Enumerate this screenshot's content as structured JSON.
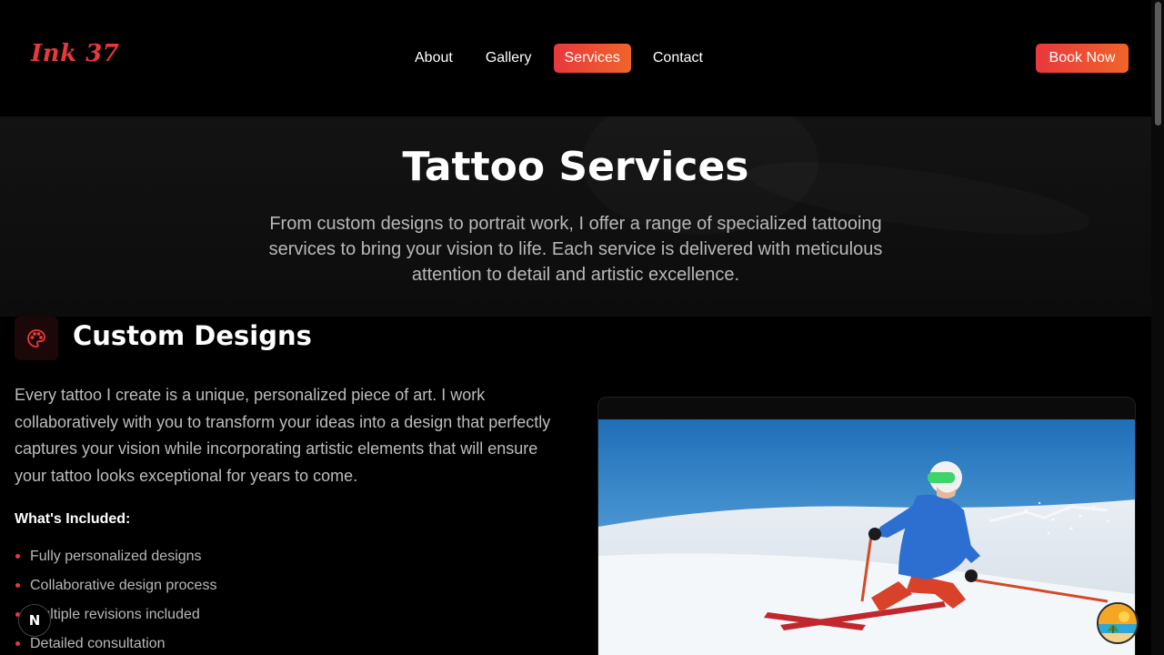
{
  "brand": {
    "logo": "Ink 37",
    "accent": "#e8383d",
    "accent_end": "#f0642a"
  },
  "nav": {
    "items": [
      {
        "label": "About",
        "active": false
      },
      {
        "label": "Gallery",
        "active": false
      },
      {
        "label": "Services",
        "active": true
      },
      {
        "label": "Contact",
        "active": false
      }
    ],
    "cta": "Book Now"
  },
  "hero": {
    "title": "Tattoo Services",
    "description": "From custom designs to portrait work, I offer a range of specialized tattooing services to bring your vision to life. Each service is delivered with meticulous attention to detail and artistic excellence."
  },
  "service": {
    "icon": "palette-icon",
    "title": "Custom Designs",
    "description": "Every tattoo I create is a unique, personalized piece of art. I work collaboratively with you to transform your ideas into a design that perfectly captures your vision while incorporating artistic elements that will ensure your tattoo looks exceptional for years to come.",
    "included_title": "What's Included:",
    "features": [
      "Fully personalized designs",
      "Collaborative design process",
      "Multiple revisions included",
      "Detailed consultation"
    ],
    "image": "skier-photo"
  },
  "overlay": {
    "framework_badge": "N",
    "avatar": "beach-avatar-icon"
  }
}
